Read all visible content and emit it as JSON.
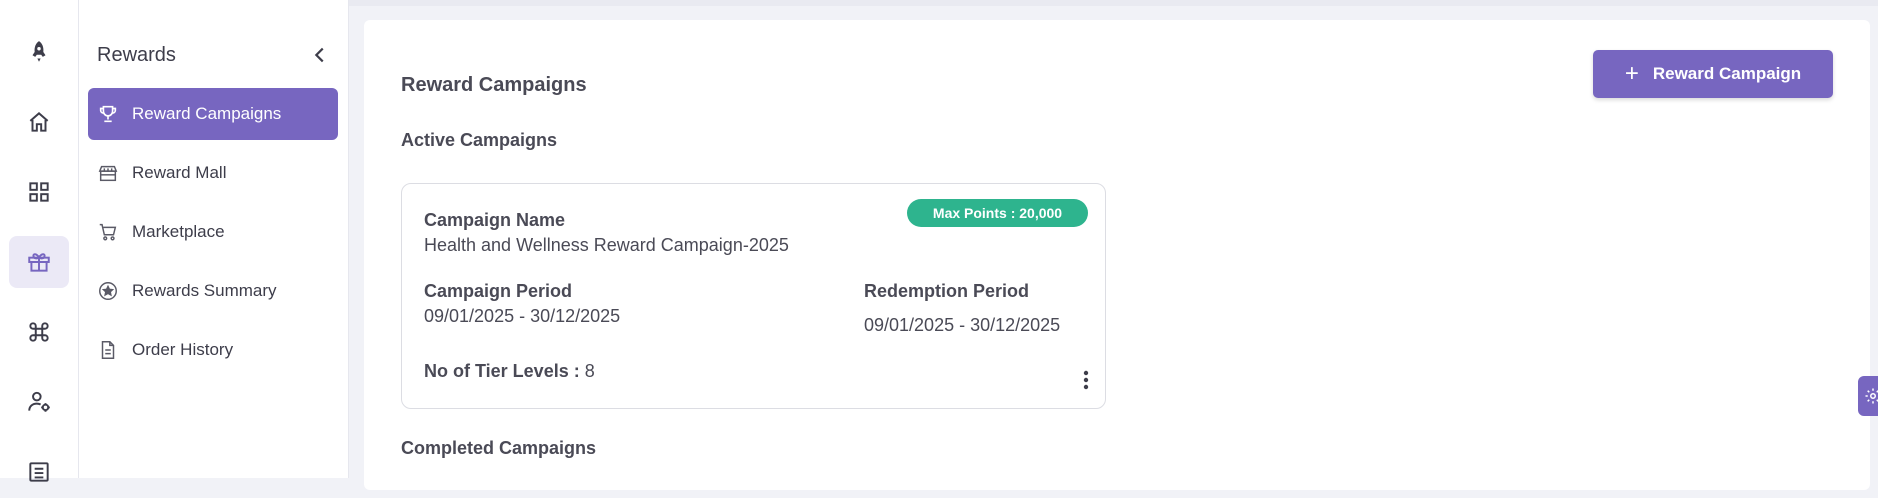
{
  "rail": {
    "items": [
      {
        "icon": "rocket-icon",
        "active": false
      },
      {
        "icon": "home-icon",
        "active": false
      },
      {
        "icon": "grid-icon",
        "active": false
      },
      {
        "icon": "gift-icon",
        "active": true
      },
      {
        "icon": "command-icon",
        "active": false
      },
      {
        "icon": "user-settings-icon",
        "active": false
      },
      {
        "icon": "list-icon",
        "active": false
      }
    ]
  },
  "sidebar": {
    "title": "Rewards",
    "items": [
      {
        "label": "Reward Campaigns",
        "icon": "trophy-icon",
        "active": true
      },
      {
        "label": "Reward Mall",
        "icon": "store-icon",
        "active": false
      },
      {
        "label": "Marketplace",
        "icon": "cart-icon",
        "active": false
      },
      {
        "label": "Rewards Summary",
        "icon": "star-circle-icon",
        "active": false
      },
      {
        "label": "Order History",
        "icon": "document-icon",
        "active": false
      }
    ]
  },
  "main": {
    "title": "Reward Campaigns",
    "add_button_label": "Reward Campaign",
    "active_section_title": "Active Campaigns",
    "completed_section_title": "Completed Campaigns",
    "campaign": {
      "badge": "Max Points : 20,000",
      "name_label": "Campaign Name",
      "name": "Health and Wellness Reward Campaign-2025",
      "period_label": "Campaign Period",
      "period": "09/01/2025 - 30/12/2025",
      "redemption_label": "Redemption Period",
      "redemption": "09/01/2025 - 30/12/2025",
      "tiers_label": "No of Tier Levels :",
      "tiers": "8"
    }
  },
  "colors": {
    "accent": "#7766c0",
    "badge": "#2eb48e",
    "background": "#f1f2f7"
  }
}
